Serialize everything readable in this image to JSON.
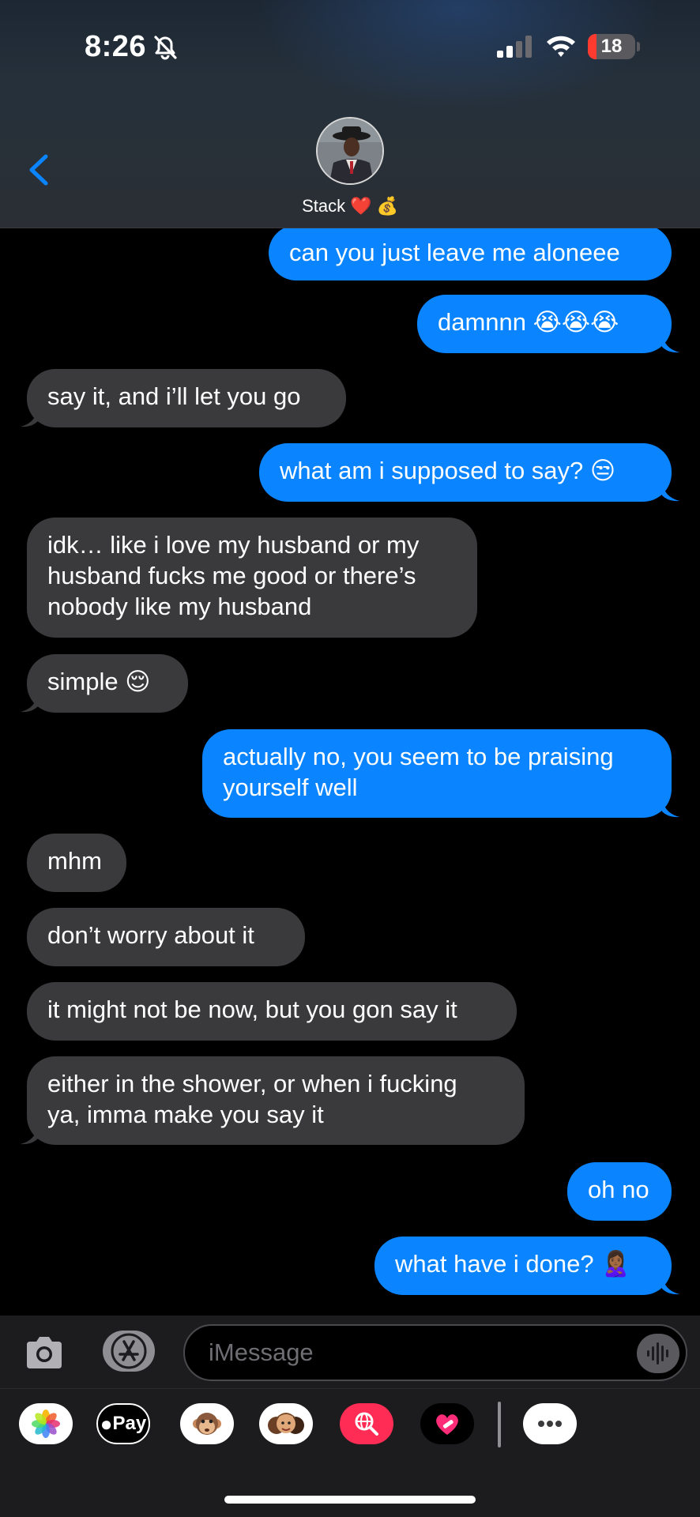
{
  "status_bar": {
    "time": "8:26",
    "battery_level": "18",
    "battery_fraction": 0.18
  },
  "header": {
    "contact_name": "Stack",
    "name_emoji_1": "❤️",
    "name_emoji_2": "💰"
  },
  "messages": [
    {
      "side": "sent",
      "text": "can you just leave me aloneee"
    },
    {
      "side": "sent",
      "text": "damnnn 😭😭😭"
    },
    {
      "side": "recv",
      "text": "say it, and i’ll let you go"
    },
    {
      "side": "sent",
      "text": "what am i supposed to say? 😒"
    },
    {
      "side": "recv",
      "text": "idk… like i love my husband or my\nhusband fucks me good or there’s\nnobody like my husband"
    },
    {
      "side": "recv",
      "text": "simple 😌"
    },
    {
      "side": "sent",
      "text": "actually no, you seem to be praising\nyourself well"
    },
    {
      "side": "recv",
      "text": "mhm"
    },
    {
      "side": "recv",
      "text": "don’t worry about it"
    },
    {
      "side": "recv",
      "text": "it might not be now, but you gon say it"
    },
    {
      "side": "recv",
      "text": "either in the shower, or when i fucking\nya, imma make you say it"
    },
    {
      "side": "sent",
      "text": "oh no"
    },
    {
      "side": "sent",
      "text": "what have i done? 🙎🏾‍♀️"
    }
  ],
  "input": {
    "placeholder": "iMessage"
  },
  "app_drawer": {
    "apple_pay_label": "Pay",
    "apps": [
      "photos",
      "apple-pay",
      "animoji",
      "memoji-stickers",
      "image-search",
      "digital-touch",
      "more"
    ]
  },
  "colors": {
    "sent_bubble": "#0a84ff",
    "received_bubble": "#3a3a3c",
    "accent": "#0a84ff"
  }
}
